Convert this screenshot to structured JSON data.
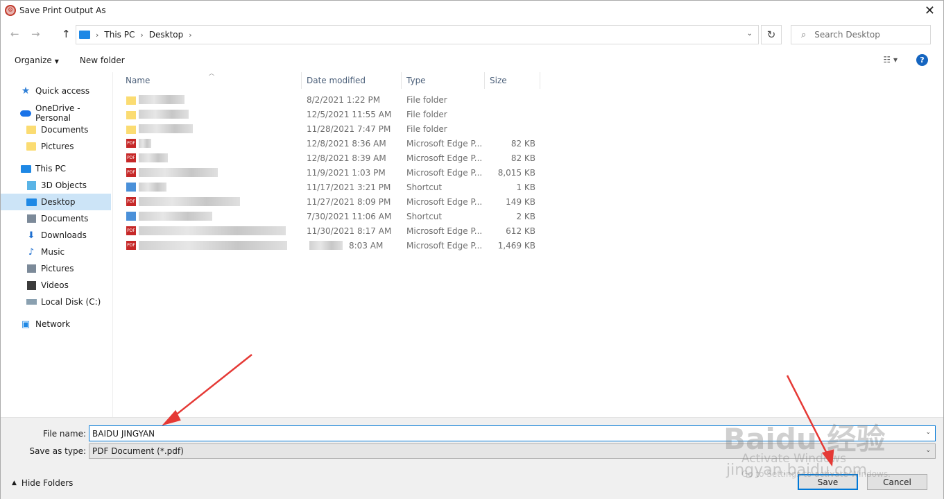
{
  "window": {
    "title": "Save Print Output As",
    "close_glyph": "✕"
  },
  "nav": {
    "back_glyph": "←",
    "forward_glyph": "→",
    "up_glyph": "↑",
    "breadcrumb": [
      "This PC",
      "Desktop"
    ],
    "refresh_glyph": "↻",
    "search_placeholder": "Search Desktop"
  },
  "toolbar": {
    "organize_label": "Organize",
    "new_folder_label": "New folder",
    "help_label": "?"
  },
  "sidebar": {
    "items": [
      {
        "label": "Quick access",
        "icon": "star-icon"
      },
      {
        "label": "OneDrive - Personal",
        "icon": "cloud-icon"
      },
      {
        "label": "Documents",
        "icon": "folder-icon"
      },
      {
        "label": "Pictures",
        "icon": "folder-icon"
      },
      {
        "label": "This PC",
        "icon": "pc-icon"
      },
      {
        "label": "3D Objects",
        "icon": "cube-icon"
      },
      {
        "label": "Desktop",
        "icon": "desktop-icon",
        "selected": true
      },
      {
        "label": "Documents",
        "icon": "documents-icon"
      },
      {
        "label": "Downloads",
        "icon": "download-icon"
      },
      {
        "label": "Music",
        "icon": "music-icon"
      },
      {
        "label": "Pictures",
        "icon": "pictures-icon"
      },
      {
        "label": "Videos",
        "icon": "videos-icon"
      },
      {
        "label": "Local Disk (C:)",
        "icon": "disk-icon"
      },
      {
        "label": "Network",
        "icon": "network-icon"
      }
    ]
  },
  "columns": {
    "name": "Name",
    "date": "Date modified",
    "type": "Type",
    "size": "Size"
  },
  "files": [
    {
      "kind": "folder",
      "date": "8/2/2021 1:22 PM",
      "type": "File folder",
      "size": ""
    },
    {
      "kind": "folder",
      "date": "12/5/2021 11:55 AM",
      "type": "File folder",
      "size": ""
    },
    {
      "kind": "folder",
      "date": "11/28/2021 7:47 PM",
      "type": "File folder",
      "size": ""
    },
    {
      "kind": "pdf",
      "date": "12/8/2021 8:36 AM",
      "type": "Microsoft Edge P...",
      "size": "82 KB"
    },
    {
      "kind": "pdf",
      "date": "12/8/2021 8:39 AM",
      "type": "Microsoft Edge P...",
      "size": "82 KB"
    },
    {
      "kind": "pdf",
      "date": "11/9/2021 1:03 PM",
      "type": "Microsoft Edge P...",
      "size": "8,015 KB"
    },
    {
      "kind": "shortcut",
      "date": "11/17/2021 3:21 PM",
      "type": "Shortcut",
      "size": "1 KB"
    },
    {
      "kind": "pdf",
      "date": "11/27/2021 8:09 PM",
      "type": "Microsoft Edge P...",
      "size": "149 KB"
    },
    {
      "kind": "shortcut",
      "date": "7/30/2021 11:06 AM",
      "type": "Shortcut",
      "size": "2 KB"
    },
    {
      "kind": "pdf",
      "date": "11/30/2021 8:17 AM",
      "type": "Microsoft Edge P...",
      "size": "612 KB"
    },
    {
      "kind": "pdf",
      "date": "8:03 AM",
      "type": "Microsoft Edge P...",
      "size": "1,469 KB"
    }
  ],
  "form": {
    "file_name_label": "File name:",
    "file_name_value": "BAIDU JINGYAN",
    "save_type_label": "Save as type:",
    "save_type_value": "PDF Document (*.pdf)",
    "hide_folders_label": "Hide Folders",
    "save_label": "Save",
    "cancel_label": "Cancel"
  },
  "overlay": {
    "activate_line1": "Activate Windows",
    "activate_line2": "Go to Settings to activate Windows.",
    "watermark_text": "Baidu 经验",
    "watermark_url": "jingyan.baidu.com"
  },
  "colors": {
    "accent": "#0078d7",
    "selection": "#cce4f7",
    "annotation_arrow": "#e53935"
  }
}
